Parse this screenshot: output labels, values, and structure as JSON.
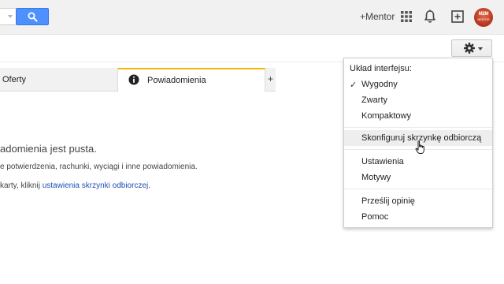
{
  "header": {
    "mentor_link": "+Mentor",
    "avatar_logo_text": "M2M",
    "avatar_logo_sub": "MENTOR"
  },
  "icons": {
    "search": "search-icon",
    "apps": "apps-grid-icon",
    "notifications": "bell-icon",
    "share": "share-plus-icon",
    "settings": "gear-icon",
    "info": "info-icon"
  },
  "colors": {
    "search_button": "#4d90fe",
    "active_tab_accent": "#f4b400",
    "link": "#1a4fb5"
  },
  "tabs": [
    {
      "label": "Oferty"
    },
    {
      "label": "Powiadomienia"
    },
    {
      "label": "+"
    }
  ],
  "main": {
    "empty_title": "adomienia jest pusta.",
    "empty_line1": "e potwierdzenia, rachunki, wyciągi i inne powiadomienia.",
    "empty_line2_prefix": "karty, kliknij ",
    "empty_line2_link": "ustawienia skrzynki odbiorczej",
    "empty_line2_suffix": "."
  },
  "menu": {
    "header": "Układ interfejsu:",
    "density": [
      {
        "label": "Wygodny",
        "checked": true
      },
      {
        "label": "Zwarty"
      },
      {
        "label": "Kompaktowy"
      }
    ],
    "configure": "Skonfiguruj skrzynkę odbiorczą",
    "settings": "Ustawienia",
    "themes": "Motywy",
    "feedback": "Prześlij opinię",
    "help": "Pomoc"
  }
}
